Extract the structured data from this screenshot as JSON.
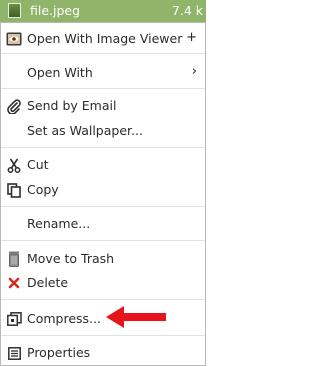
{
  "file": {
    "name": "file.jpeg",
    "size": "7.4 k"
  },
  "menu": {
    "open_with_viewer": {
      "label": "Open With Image Viewer",
      "suffix": "+"
    },
    "open_with": {
      "label": "Open With",
      "suffix": "›"
    },
    "send_email": {
      "label": "Send by Email"
    },
    "wallpaper": {
      "label": "Set as Wallpaper..."
    },
    "cut": {
      "label": "Cut"
    },
    "copy": {
      "label": "Copy"
    },
    "rename": {
      "label": "Rename..."
    },
    "trash": {
      "label": "Move to Trash"
    },
    "delete": {
      "label": "Delete"
    },
    "compress": {
      "label": "Compress..."
    },
    "properties": {
      "label": "Properties"
    }
  },
  "colors": {
    "file_bar": "#90b56a",
    "annotation_arrow": "#e8141b",
    "delete_icon": "#d42a1e"
  },
  "icons": [
    "image-viewer-icon",
    "email-clip-icon",
    "scissors-icon",
    "copy-icon",
    "trash-can-icon",
    "delete-x-icon",
    "archive-icon",
    "properties-icon"
  ]
}
